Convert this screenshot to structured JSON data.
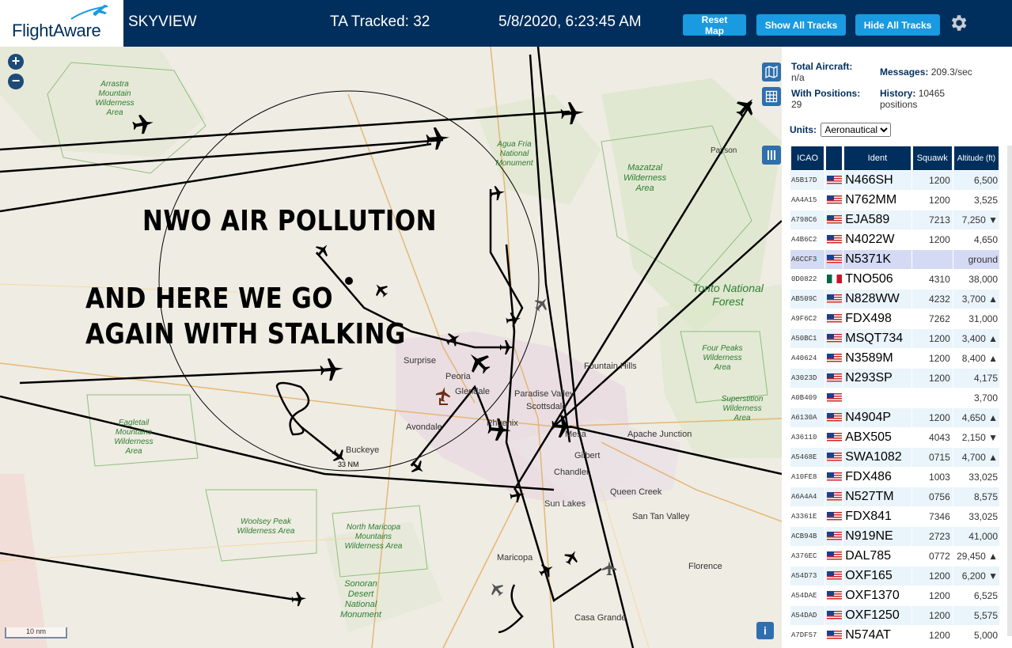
{
  "header": {
    "logo": "FlightAware",
    "app_title": "SKYVIEW",
    "tracked": "TA Tracked: 32",
    "datetime": "5/8/2020, 6:23:45 AM",
    "reset_map": "Reset Map",
    "show_all": "Show All Tracks",
    "hide_all": "Hide All Tracks"
  },
  "map": {
    "zoom_in": "+",
    "zoom_out": "−",
    "range_label": "33 NM",
    "scale": "10 nm",
    "info": "i",
    "overlay_line1": "NWO AIR POLLUTION",
    "overlay_line2": "AND HERE WE GO",
    "overlay_line3": "AGAIN WITH STALKING",
    "places": [
      "Surprise",
      "Peoria",
      "Glendale",
      "Paradise Valley",
      "Scottsdale",
      "Fountain Hills",
      "Avondale",
      "Phoenix",
      "Mesa",
      "Apache Junction",
      "Buckeye",
      "Gilbert",
      "Chandler",
      "Queen Creek",
      "Sun Lakes",
      "San Tan Valley",
      "Maricopa",
      "Florence",
      "Casa Grande",
      "Payson"
    ],
    "wilderness": [
      "Arrastra Mountain Wilderness Area",
      "Agua Fria National Monument",
      "Mazatzal Wilderness Area",
      "Four Peaks Wilderness Area",
      "Superstition Wilderness Area",
      "Eagletail Mountains Wilderness Area",
      "Woolsey Peak Wilderness Area",
      "North Maricopa Mountains Wilderness Area",
      "Sonoran Desert National Monument"
    ],
    "forest": "Tonto National Forest"
  },
  "panel": {
    "total_label": "Total Aircraft:",
    "total_value": "n/a",
    "messages_label": "Messages:",
    "messages_value": "209.3/sec",
    "positions_label": "With Positions:",
    "positions_value": "29",
    "history_label": "History:",
    "history_value": "10465 positions",
    "units_label": "Units:",
    "units_value": "Aeronautical",
    "columns": [
      "ICAO",
      "Ident",
      "Squawk",
      "Altitude (ft)"
    ],
    "rows": [
      {
        "icao": "A5B17D",
        "flag": "us",
        "ident": "N466SH",
        "squawk": "1200",
        "alt": "6,500"
      },
      {
        "icao": "AA4A15",
        "flag": "us",
        "ident": "N762MM",
        "squawk": "1200",
        "alt": "3,525"
      },
      {
        "icao": "A798C6",
        "flag": "us",
        "ident": "EJA589",
        "squawk": "7213",
        "alt": "7,250 ▼"
      },
      {
        "icao": "A4B6C2",
        "flag": "us",
        "ident": "N4022W",
        "squawk": "1200",
        "alt": "4,650"
      },
      {
        "icao": "A6CCF3",
        "flag": "us",
        "ident": "N5371K",
        "squawk": "",
        "alt": "ground"
      },
      {
        "icao": "0D0822",
        "flag": "mx",
        "ident": "TNO506",
        "squawk": "4310",
        "alt": "38,000"
      },
      {
        "icao": "AB509C",
        "flag": "us",
        "ident": "N828WW",
        "squawk": "4232",
        "alt": "3,700 ▲"
      },
      {
        "icao": "A9F6C2",
        "flag": "us",
        "ident": "FDX498",
        "squawk": "7262",
        "alt": "31,000"
      },
      {
        "icao": "A50BC1",
        "flag": "us",
        "ident": "MSQT734",
        "squawk": "1200",
        "alt": "3,400 ▲"
      },
      {
        "icao": "A40624",
        "flag": "us",
        "ident": "N3589M",
        "squawk": "1200",
        "alt": "8,400 ▲"
      },
      {
        "icao": "A3023D",
        "flag": "us",
        "ident": "N293SP",
        "squawk": "1200",
        "alt": "4,175"
      },
      {
        "icao": "A0B409",
        "flag": "us",
        "ident": "",
        "squawk": "",
        "alt": "3,700"
      },
      {
        "icao": "A6130A",
        "flag": "us",
        "ident": "N4904P",
        "squawk": "1200",
        "alt": "4,650 ▲"
      },
      {
        "icao": "A36110",
        "flag": "us",
        "ident": "ABX505",
        "squawk": "4043",
        "alt": "2,150 ▼"
      },
      {
        "icao": "A5468E",
        "flag": "us",
        "ident": "SWA1082",
        "squawk": "0715",
        "alt": "4,700 ▲"
      },
      {
        "icao": "A10FE8",
        "flag": "us",
        "ident": "FDX486",
        "squawk": "1003",
        "alt": "33,025"
      },
      {
        "icao": "A6A4A4",
        "flag": "us",
        "ident": "N527TM",
        "squawk": "0756",
        "alt": "8,575"
      },
      {
        "icao": "A3361E",
        "flag": "us",
        "ident": "FDX841",
        "squawk": "7346",
        "alt": "33,025"
      },
      {
        "icao": "ACB94B",
        "flag": "us",
        "ident": "N919NE",
        "squawk": "2723",
        "alt": "41,000"
      },
      {
        "icao": "A376EC",
        "flag": "us",
        "ident": "DAL785",
        "squawk": "0772",
        "alt": "29,450 ▲"
      },
      {
        "icao": "A54D73",
        "flag": "us",
        "ident": "OXF165",
        "squawk": "1200",
        "alt": "6,200 ▼"
      },
      {
        "icao": "A54DAE",
        "flag": "us",
        "ident": "OXF1370",
        "squawk": "1200",
        "alt": "6,525"
      },
      {
        "icao": "A54DAD",
        "flag": "us",
        "ident": "OXF1250",
        "squawk": "1200",
        "alt": "5,575"
      },
      {
        "icao": "A7DF57",
        "flag": "us",
        "ident": "N574AT",
        "squawk": "1200",
        "alt": "5,000"
      }
    ]
  },
  "colors": {
    "header": "#002f5d",
    "button": "#1a9ae0",
    "wilderness": "#2e7d32",
    "track": "#000000"
  }
}
